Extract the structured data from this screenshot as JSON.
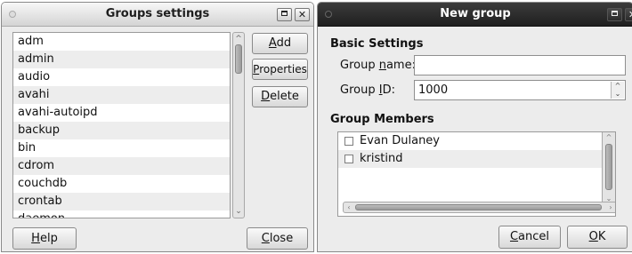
{
  "groups_window": {
    "title": "Groups settings",
    "groups": [
      "adm",
      "admin",
      "audio",
      "avahi",
      "avahi-autoipd",
      "backup",
      "bin",
      "cdrom",
      "couchdb",
      "crontab",
      "daemon"
    ],
    "add": {
      "mnemonic": "A",
      "rest": "dd"
    },
    "properties": {
      "mnemonic": "P",
      "rest": "roperties"
    },
    "delete": {
      "mnemonic": "D",
      "rest": "elete"
    },
    "help": {
      "mnemonic": "H",
      "rest": "elp"
    },
    "close": {
      "mnemonic": "C",
      "rest": "lose"
    }
  },
  "new_group_window": {
    "title": "New group",
    "basic_settings_heading": "Basic Settings",
    "group_name_label": {
      "pre": "Group ",
      "mnemonic": "n",
      "post": "ame:"
    },
    "group_name_value": "",
    "group_id_label": {
      "pre": "Group ",
      "mnemonic": "I",
      "post": "D:"
    },
    "group_id_value": "1000",
    "members_heading": "Group Members",
    "members": [
      {
        "name": "Evan Dulaney",
        "checked": false
      },
      {
        "name": "kristind",
        "checked": false
      }
    ],
    "cancel": {
      "mnemonic": "C",
      "rest": "ancel"
    },
    "ok": {
      "mnemonic": "O",
      "rest": "K"
    }
  }
}
